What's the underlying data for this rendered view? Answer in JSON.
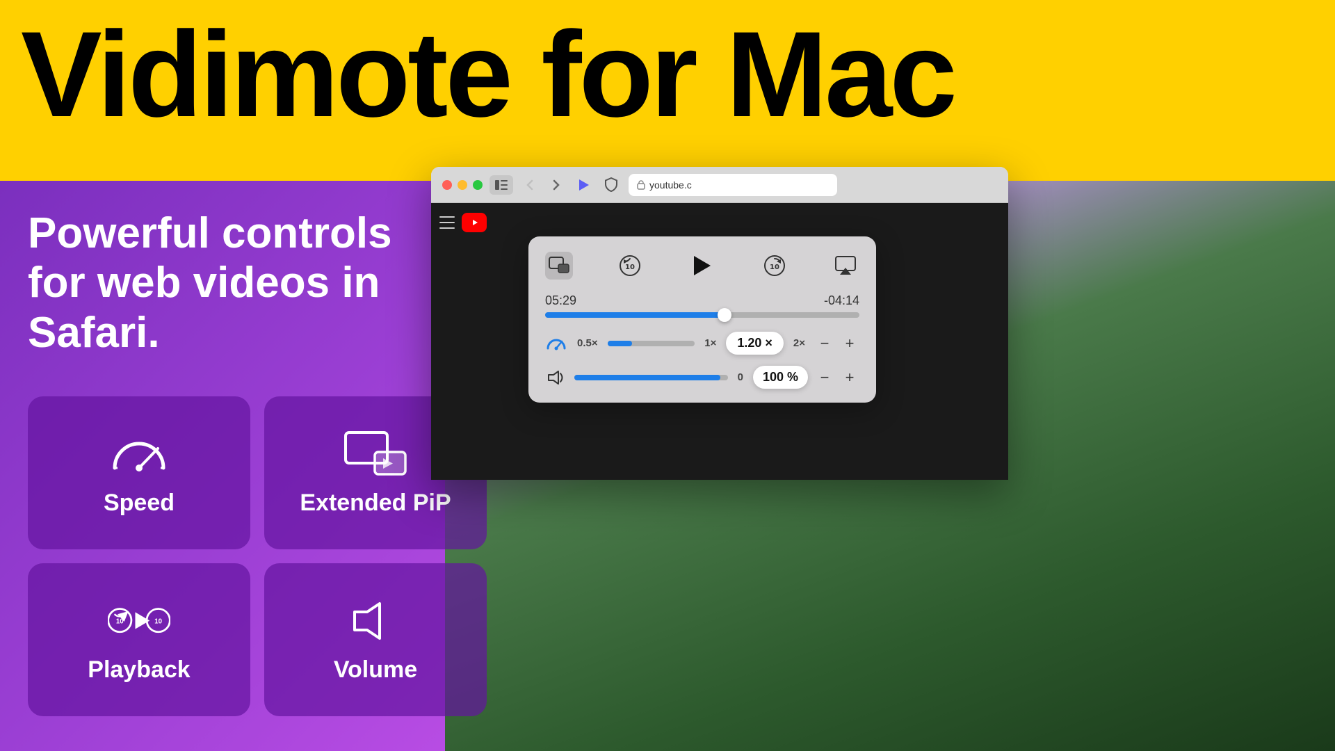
{
  "header": {
    "title": "Vidimote for Mac",
    "title_color": "#000000",
    "bg_color": "#FFD000"
  },
  "subtitle": {
    "text": "Powerful controls for web videos in Safari.",
    "color": "#ffffff"
  },
  "features": [
    {
      "id": "speed",
      "label": "Speed",
      "icon": "speed-icon"
    },
    {
      "id": "extended-pip",
      "label": "Extended PiP",
      "icon": "pip-icon"
    },
    {
      "id": "playback",
      "label": "Playback",
      "icon": "playback-icon"
    },
    {
      "id": "volume",
      "label": "Volume",
      "icon": "volume-icon"
    }
  ],
  "browser": {
    "url": "youtube.c",
    "lock_icon": "lock-icon"
  },
  "panel": {
    "time_current": "05:29",
    "time_remaining": "-04:14",
    "progress_percent": 57,
    "speed_value": "1.20 ×",
    "speed_min": "0.5×",
    "speed_max": "2×",
    "speed_mid": "1×",
    "volume_value": "100 %",
    "volume_min": "0"
  }
}
